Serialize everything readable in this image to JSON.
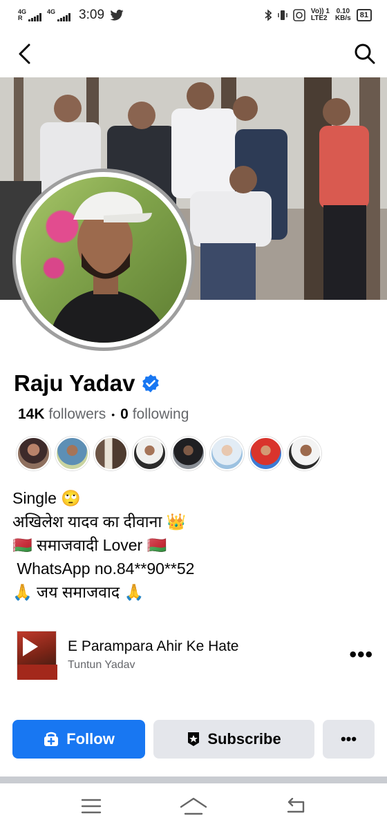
{
  "status_bar": {
    "sim1_label_top": "4G",
    "sim1_label_bottom": "R",
    "sim2_label": "4G",
    "time": "3:09",
    "volte_top": "Vo)) 1",
    "volte_bottom": "LTE2",
    "speed_value": "0.10",
    "speed_unit": "KB/s",
    "battery": "81"
  },
  "header": {
    "back_icon": "back-arrow-icon",
    "search_icon": "search-icon"
  },
  "profile": {
    "name": "Raju Yadav",
    "verified_icon": "verified-badge-icon",
    "followers_count": "14K",
    "followers_label": "followers",
    "separator": "•",
    "following_count": "0",
    "following_label": "following"
  },
  "bio": {
    "lines": [
      "Single 🙄",
      "अखिलेश यादव का दीवाना 👑",
      "🇧🇾 समाजवादी Lover 🇧🇾",
      " WhatsApp no.84**90**52",
      "🙏 जय समाजवाद 🙏"
    ]
  },
  "music": {
    "song": "E Parampara Ahir Ke Hate",
    "artist": "Tuntun Yadav",
    "more_label": "•••"
  },
  "actions": {
    "follow_label": "Follow",
    "subscribe_label": "Subscribe",
    "more_label": "•••"
  },
  "colors": {
    "accent": "#1877f2",
    "secondary_button": "#e4e6eb",
    "muted_text": "#65676b"
  }
}
